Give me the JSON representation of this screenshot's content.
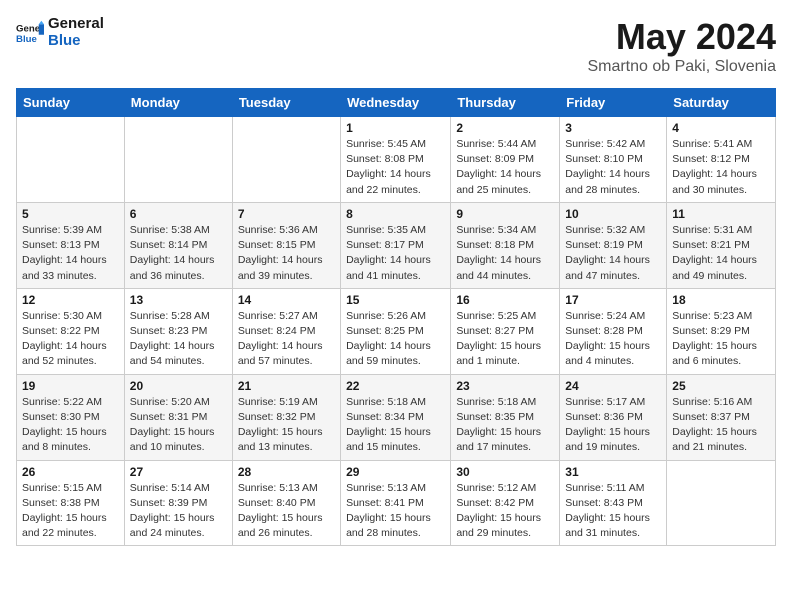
{
  "header": {
    "logo_general": "General",
    "logo_blue": "Blue",
    "month_title": "May 2024",
    "location": "Smartno ob Paki, Slovenia"
  },
  "weekdays": [
    "Sunday",
    "Monday",
    "Tuesday",
    "Wednesday",
    "Thursday",
    "Friday",
    "Saturday"
  ],
  "weeks": [
    [
      {
        "day": "",
        "sunrise": "",
        "sunset": "",
        "daylight": ""
      },
      {
        "day": "",
        "sunrise": "",
        "sunset": "",
        "daylight": ""
      },
      {
        "day": "",
        "sunrise": "",
        "sunset": "",
        "daylight": ""
      },
      {
        "day": "1",
        "sunrise": "Sunrise: 5:45 AM",
        "sunset": "Sunset: 8:08 PM",
        "daylight": "Daylight: 14 hours and 22 minutes."
      },
      {
        "day": "2",
        "sunrise": "Sunrise: 5:44 AM",
        "sunset": "Sunset: 8:09 PM",
        "daylight": "Daylight: 14 hours and 25 minutes."
      },
      {
        "day": "3",
        "sunrise": "Sunrise: 5:42 AM",
        "sunset": "Sunset: 8:10 PM",
        "daylight": "Daylight: 14 hours and 28 minutes."
      },
      {
        "day": "4",
        "sunrise": "Sunrise: 5:41 AM",
        "sunset": "Sunset: 8:12 PM",
        "daylight": "Daylight: 14 hours and 30 minutes."
      }
    ],
    [
      {
        "day": "5",
        "sunrise": "Sunrise: 5:39 AM",
        "sunset": "Sunset: 8:13 PM",
        "daylight": "Daylight: 14 hours and 33 minutes."
      },
      {
        "day": "6",
        "sunrise": "Sunrise: 5:38 AM",
        "sunset": "Sunset: 8:14 PM",
        "daylight": "Daylight: 14 hours and 36 minutes."
      },
      {
        "day": "7",
        "sunrise": "Sunrise: 5:36 AM",
        "sunset": "Sunset: 8:15 PM",
        "daylight": "Daylight: 14 hours and 39 minutes."
      },
      {
        "day": "8",
        "sunrise": "Sunrise: 5:35 AM",
        "sunset": "Sunset: 8:17 PM",
        "daylight": "Daylight: 14 hours and 41 minutes."
      },
      {
        "day": "9",
        "sunrise": "Sunrise: 5:34 AM",
        "sunset": "Sunset: 8:18 PM",
        "daylight": "Daylight: 14 hours and 44 minutes."
      },
      {
        "day": "10",
        "sunrise": "Sunrise: 5:32 AM",
        "sunset": "Sunset: 8:19 PM",
        "daylight": "Daylight: 14 hours and 47 minutes."
      },
      {
        "day": "11",
        "sunrise": "Sunrise: 5:31 AM",
        "sunset": "Sunset: 8:21 PM",
        "daylight": "Daylight: 14 hours and 49 minutes."
      }
    ],
    [
      {
        "day": "12",
        "sunrise": "Sunrise: 5:30 AM",
        "sunset": "Sunset: 8:22 PM",
        "daylight": "Daylight: 14 hours and 52 minutes."
      },
      {
        "day": "13",
        "sunrise": "Sunrise: 5:28 AM",
        "sunset": "Sunset: 8:23 PM",
        "daylight": "Daylight: 14 hours and 54 minutes."
      },
      {
        "day": "14",
        "sunrise": "Sunrise: 5:27 AM",
        "sunset": "Sunset: 8:24 PM",
        "daylight": "Daylight: 14 hours and 57 minutes."
      },
      {
        "day": "15",
        "sunrise": "Sunrise: 5:26 AM",
        "sunset": "Sunset: 8:25 PM",
        "daylight": "Daylight: 14 hours and 59 minutes."
      },
      {
        "day": "16",
        "sunrise": "Sunrise: 5:25 AM",
        "sunset": "Sunset: 8:27 PM",
        "daylight": "Daylight: 15 hours and 1 minute."
      },
      {
        "day": "17",
        "sunrise": "Sunrise: 5:24 AM",
        "sunset": "Sunset: 8:28 PM",
        "daylight": "Daylight: 15 hours and 4 minutes."
      },
      {
        "day": "18",
        "sunrise": "Sunrise: 5:23 AM",
        "sunset": "Sunset: 8:29 PM",
        "daylight": "Daylight: 15 hours and 6 minutes."
      }
    ],
    [
      {
        "day": "19",
        "sunrise": "Sunrise: 5:22 AM",
        "sunset": "Sunset: 8:30 PM",
        "daylight": "Daylight: 15 hours and 8 minutes."
      },
      {
        "day": "20",
        "sunrise": "Sunrise: 5:20 AM",
        "sunset": "Sunset: 8:31 PM",
        "daylight": "Daylight: 15 hours and 10 minutes."
      },
      {
        "day": "21",
        "sunrise": "Sunrise: 5:19 AM",
        "sunset": "Sunset: 8:32 PM",
        "daylight": "Daylight: 15 hours and 13 minutes."
      },
      {
        "day": "22",
        "sunrise": "Sunrise: 5:18 AM",
        "sunset": "Sunset: 8:34 PM",
        "daylight": "Daylight: 15 hours and 15 minutes."
      },
      {
        "day": "23",
        "sunrise": "Sunrise: 5:18 AM",
        "sunset": "Sunset: 8:35 PM",
        "daylight": "Daylight: 15 hours and 17 minutes."
      },
      {
        "day": "24",
        "sunrise": "Sunrise: 5:17 AM",
        "sunset": "Sunset: 8:36 PM",
        "daylight": "Daylight: 15 hours and 19 minutes."
      },
      {
        "day": "25",
        "sunrise": "Sunrise: 5:16 AM",
        "sunset": "Sunset: 8:37 PM",
        "daylight": "Daylight: 15 hours and 21 minutes."
      }
    ],
    [
      {
        "day": "26",
        "sunrise": "Sunrise: 5:15 AM",
        "sunset": "Sunset: 8:38 PM",
        "daylight": "Daylight: 15 hours and 22 minutes."
      },
      {
        "day": "27",
        "sunrise": "Sunrise: 5:14 AM",
        "sunset": "Sunset: 8:39 PM",
        "daylight": "Daylight: 15 hours and 24 minutes."
      },
      {
        "day": "28",
        "sunrise": "Sunrise: 5:13 AM",
        "sunset": "Sunset: 8:40 PM",
        "daylight": "Daylight: 15 hours and 26 minutes."
      },
      {
        "day": "29",
        "sunrise": "Sunrise: 5:13 AM",
        "sunset": "Sunset: 8:41 PM",
        "daylight": "Daylight: 15 hours and 28 minutes."
      },
      {
        "day": "30",
        "sunrise": "Sunrise: 5:12 AM",
        "sunset": "Sunset: 8:42 PM",
        "daylight": "Daylight: 15 hours and 29 minutes."
      },
      {
        "day": "31",
        "sunrise": "Sunrise: 5:11 AM",
        "sunset": "Sunset: 8:43 PM",
        "daylight": "Daylight: 15 hours and 31 minutes."
      },
      {
        "day": "",
        "sunrise": "",
        "sunset": "",
        "daylight": ""
      }
    ]
  ]
}
